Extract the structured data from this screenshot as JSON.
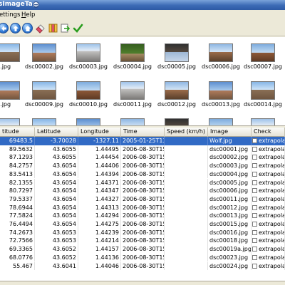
{
  "window": {
    "title": "sImageTag"
  },
  "menu": {
    "settings_rest": "ettings",
    "help_h": "H",
    "help_rest": "elp"
  },
  "toolbar": {
    "buttons": [
      "back-icon",
      "up-icon",
      "home-icon",
      "eraser-icon",
      "columns-icon",
      "sync-icon",
      "checkmark-icon"
    ]
  },
  "thumbnails": [
    "001.jpg",
    "dsc00002.jpg",
    "dsc00003.jpg",
    "dsc00004.jpg",
    "dsc00005.jpg",
    "dsc00006.jpg",
    "dsc00007.jpg",
    "008.jpg",
    "dsc00009.jpg",
    "dsc00010.jpg",
    "dsc00011.jpg",
    "dsc00012.jpg",
    "dsc00013.jpg",
    "dsc00014.jpg"
  ],
  "table": {
    "columns": [
      "titude",
      "Latitude",
      "Longitude",
      "Time",
      "Speed (km/h)",
      "Image",
      "Check"
    ],
    "rows": [
      [
        "69483.5",
        "-3.70028",
        "-1327.11",
        "2005-01-25T13:4",
        "",
        "Wolf.jpg",
        "extrapolat"
      ],
      [
        "89.5632",
        "43.6055",
        "1.44495",
        "2006-08-30T15:",
        "",
        "dsc00001.jpg",
        "extrapolat"
      ],
      [
        "87.1293",
        "43.6055",
        "1.44454",
        "2006-08-30T15:",
        "",
        "dsc00002.jpg",
        "extrapolat"
      ],
      [
        "84.2757",
        "43.6054",
        "1.44406",
        "2006-08-30T15:",
        "",
        "dsc00003.jpg",
        "extrapolat"
      ],
      [
        "83.5413",
        "43.6054",
        "1.44394",
        "2006-08-30T15:",
        "",
        "dsc00004.jpg",
        "extrapolat"
      ],
      [
        "82.1355",
        "43.6054",
        "1.44371",
        "2006-08-30T15:",
        "",
        "dsc00005.jpg",
        "extrapolat"
      ],
      [
        "80.7297",
        "43.6054",
        "1.44347",
        "2006-08-30T15:",
        "",
        "dsc00006.jpg",
        "extrapolat"
      ],
      [
        "79.5337",
        "43.6054",
        "1.44327",
        "2006-08-30T15:",
        "",
        "dsc00011.jpg",
        "extrapolat"
      ],
      [
        "78.6944",
        "43.6054",
        "1.44313",
        "2006-08-30T15:",
        "",
        "dsc00012.jpg",
        "extrapolat"
      ],
      [
        "77.5824",
        "43.6054",
        "1.44294",
        "2006-08-30T15:",
        "",
        "dsc00013.jpg",
        "extrapolat"
      ],
      [
        "76.4494",
        "43.6054",
        "1.44275",
        "2006-08-30T15:",
        "",
        "dsc00015.jpg",
        "extrapolat"
      ],
      [
        "74.2673",
        "43.6053",
        "1.44239",
        "2006-08-30T15:",
        "",
        "dsc00016.jpg",
        "extrapolat"
      ],
      [
        "72.7566",
        "43.6053",
        "1.44214",
        "2006-08-30T15:",
        "",
        "dsc00018.jpg",
        "extrapolat"
      ],
      [
        "69.3365",
        "43.6052",
        "1.44157",
        "2006-08-30T15:",
        "",
        "dsc00019a.jpg",
        "extrapolat"
      ],
      [
        "68.0776",
        "43.6052",
        "1.44136",
        "2006-08-30T15:",
        "",
        "dsc00023.jpg",
        "extrapolat"
      ],
      [
        "55.467",
        "43.6041",
        "1.44046",
        "2006-08-30T15:",
        "",
        "dsc00024.jpg",
        "extrapolat"
      ]
    ]
  },
  "colors": {
    "selection": "#316ac5",
    "titlebar": "#3b6ab5",
    "check_mark": "#2a9d1f"
  }
}
